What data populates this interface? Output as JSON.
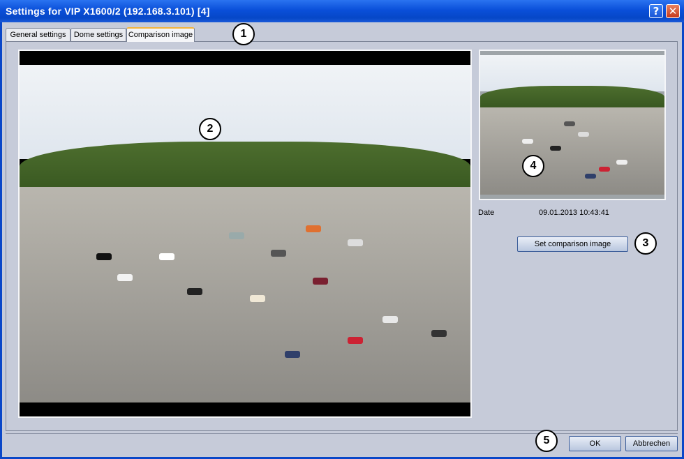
{
  "window": {
    "title": "Settings for VIP X1600/2 (192.168.3.101) [4]",
    "help_label": "?",
    "close_label": "✕"
  },
  "tabs": [
    {
      "label": "General settings",
      "active": false
    },
    {
      "label": "Dome settings",
      "active": false
    },
    {
      "label": "Comparison image",
      "active": true
    }
  ],
  "comparison": {
    "date_label": "Date",
    "date_value": "09.01.2013 10:43:41",
    "set_button": "Set comparison image"
  },
  "footer": {
    "ok": "OK",
    "cancel": "Abbrechen"
  },
  "callouts": [
    "1",
    "2",
    "3",
    "4",
    "5"
  ],
  "icons": {
    "help": "help-icon",
    "close": "close-icon"
  },
  "colors": {
    "titlebar": "#0a4fd9",
    "panel": "#c6cbd9",
    "tab_highlight": "#f3b43c"
  }
}
